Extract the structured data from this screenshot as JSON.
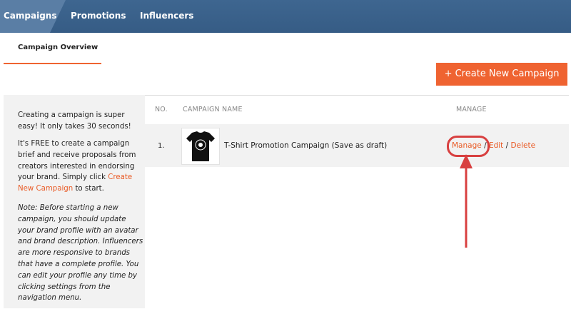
{
  "nav": {
    "tabs": [
      {
        "label": "Campaigns",
        "active": true
      },
      {
        "label": "Promotions",
        "active": false
      },
      {
        "label": "Influencers",
        "active": false
      }
    ]
  },
  "subnav": {
    "active_tab": "Campaign Overview"
  },
  "create_button": "+ Create New Campaign",
  "sidebar": {
    "intro": "Creating a campaign is super easy! It only takes 30 seconds!",
    "body_before_link": "It's FREE to create a campaign brief and receive proposals from creators interested in endorsing your brand. Simply click ",
    "link": "Create New Campaign",
    "body_after_link": " to start.",
    "note": "Note: Before starting a new campaign, you should update your brand profile with an avatar and brand description. Influencers are more responsive to brands that have a complete profile. You can edit your profile any time by clicking settings from the navigation menu."
  },
  "table": {
    "headers": {
      "no": "NO.",
      "name": "CAMPAIGN NAME",
      "manage": "MANAGE"
    },
    "rows": [
      {
        "no": "1.",
        "name": "T-Shirt Promotion Campaign (Save as draft)",
        "thumbnail": "tshirt-image",
        "actions": {
          "manage": "Manage",
          "edit": "Edit",
          "delete": "Delete",
          "separator": "/"
        }
      }
    ]
  },
  "annotation": {
    "color": "#d84040",
    "target": "Manage"
  },
  "colors": {
    "nav_bg": "#365c85",
    "active_tab": "#5a7ea5",
    "accent": "#ef6331",
    "link": "#e95a25"
  }
}
